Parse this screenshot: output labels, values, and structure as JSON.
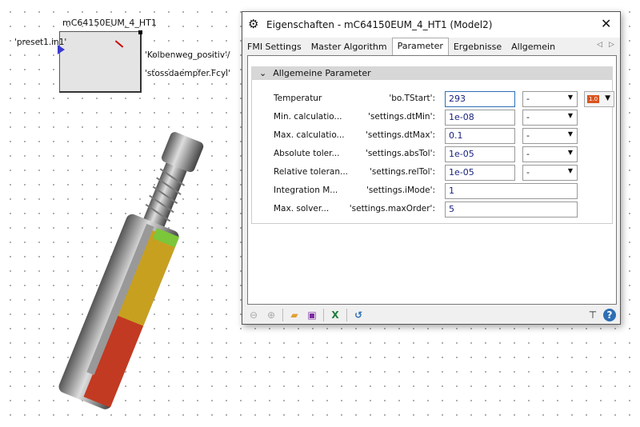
{
  "diagram": {
    "block_title": "mC64150EUM_4_HT1",
    "input_label": "'preset1.in1'",
    "output_labels": [
      "'Kolbenweg_positiv'/",
      "'stossdaempfer.Fcyl'"
    ]
  },
  "dialog": {
    "title": "Eigenschaften - mC64150EUM_4_HT1 (Model2)",
    "tabs": [
      {
        "label": "FMI Settings"
      },
      {
        "label": "Master Algorithm"
      },
      {
        "label": "Parameter"
      },
      {
        "label": "Ergebnisse"
      },
      {
        "label": "Allgemein"
      }
    ],
    "active_tab": "Parameter",
    "group_title": "Allgemeine Parameter",
    "rows": [
      {
        "name": "Temperatur",
        "param": "'bo.TStart':",
        "value": "293",
        "unit": "-"
      },
      {
        "name": "Min. calculatio...",
        "param": "'settings.dtMin':",
        "value": "1e-08",
        "unit": "-"
      },
      {
        "name": "Max. calculatio...",
        "param": "'settings.dtMax':",
        "value": "0.1",
        "unit": "-"
      },
      {
        "name": "Absolute toler...",
        "param": "'settings.absTol':",
        "value": "1e-05",
        "unit": "-"
      },
      {
        "name": "Relative toleran...",
        "param": "'settings.relTol':",
        "value": "1e-05",
        "unit": "-"
      },
      {
        "name": "Integration M...",
        "param": "'settings.iMode':",
        "value": "1"
      },
      {
        "name": "Max. solver...",
        "param": "'settings.maxOrder':",
        "value": "5"
      }
    ],
    "unit_badge": "1.0"
  },
  "colors": {
    "accent": "#2d6fb4",
    "badge": "#d9541e"
  }
}
